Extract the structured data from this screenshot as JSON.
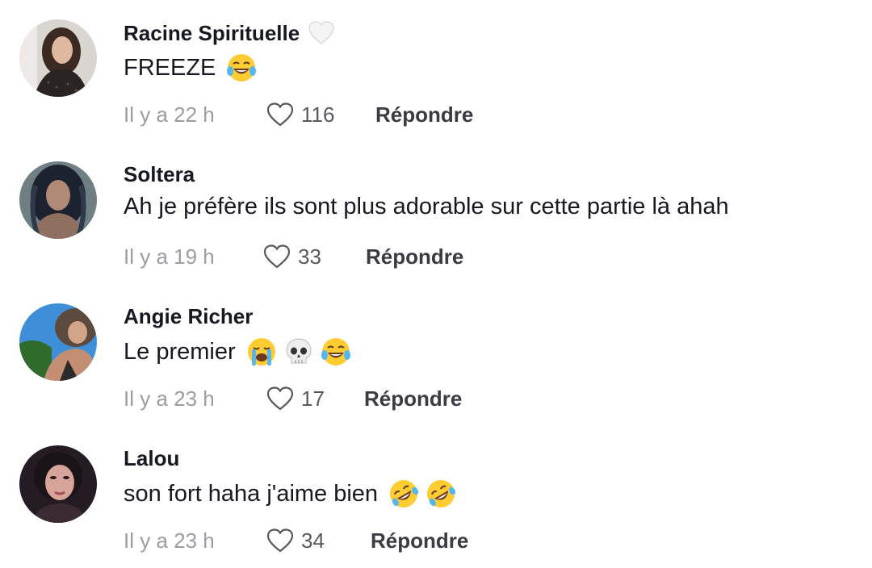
{
  "comments": [
    {
      "username": "Racine Spirituelle",
      "badge_icon": "white-heart-icon",
      "text": "FREEZE",
      "emojis": [
        "face-with-tears-of-joy"
      ],
      "time": "Il y a 22 h",
      "likes": "116",
      "reply_label": "Répondre"
    },
    {
      "username": "Soltera",
      "text": "Ah je préfère ils sont plus adorable sur cette partie là ahah",
      "emojis": [],
      "time": "Il y a 19 h",
      "likes": "33",
      "reply_label": "Répondre"
    },
    {
      "username": "Angie Richer",
      "text": "Le premier",
      "emojis": [
        "loudly-crying-face",
        "skull",
        "face-with-tears-of-joy"
      ],
      "time": "Il y a 23 h",
      "likes": "17",
      "reply_label": "Répondre"
    },
    {
      "username": "Lalou",
      "text": "son fort haha j'aime bien",
      "emojis": [
        "rolling-on-the-floor-laughing",
        "rolling-on-the-floor-laughing"
      ],
      "time": "Il y a 23 h",
      "likes": "34",
      "reply_label": "Répondre"
    }
  ],
  "icons": {
    "like": "heart-outline-icon"
  },
  "colors": {
    "username": "#161823",
    "timestamp": "#9c9ca3",
    "reply": "#3b3b44",
    "like_count": "#58585f"
  }
}
